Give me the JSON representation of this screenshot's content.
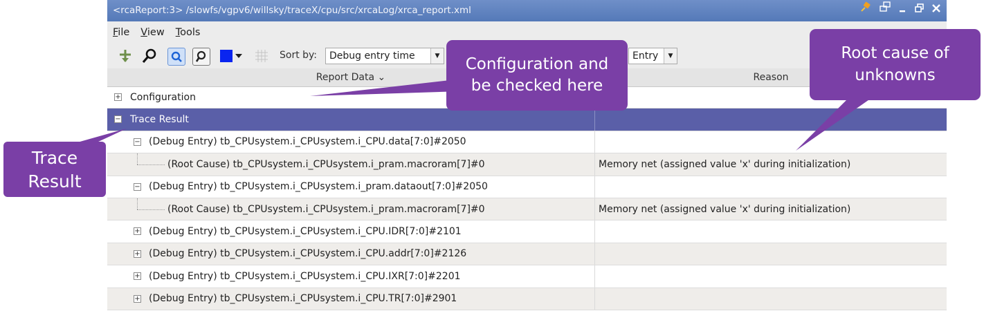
{
  "window": {
    "title": "<rcaReport:3> /slowfs/vgpv6/willsky/traceX/cpu/src/xrcaLog/xrca_report.xml"
  },
  "menu": [
    {
      "mnemonic": "F",
      "rest": "ile"
    },
    {
      "mnemonic": "V",
      "rest": "iew"
    },
    {
      "mnemonic": "T",
      "rest": "ools"
    }
  ],
  "toolbar": {
    "sort_label": "Sort by:",
    "sort_value": "Debug entry time",
    "second_value": "Entry"
  },
  "table": {
    "col1_header": "Report Data ⌄",
    "col2_header": "Reason",
    "rows": [
      {
        "label": "Configuration",
        "reason": ""
      },
      {
        "label": "Trace Result",
        "reason": ""
      },
      {
        "label": "(Debug Entry) tb_CPUsystem.i_CPUsystem.i_CPU.data[7:0]#2050",
        "reason": ""
      },
      {
        "label": "(Root Cause) tb_CPUsystem.i_CPUsystem.i_pram.macroram[7]#0",
        "reason": "Memory net (assigned value 'x' during initialization)"
      },
      {
        "label": "(Debug Entry) tb_CPUsystem.i_CPUsystem.i_pram.dataout[7:0]#2050",
        "reason": ""
      },
      {
        "label": "(Root Cause) tb_CPUsystem.i_CPUsystem.i_pram.macroram[7]#0",
        "reason": "Memory net (assigned value 'x' during initialization)"
      },
      {
        "label": "(Debug Entry) tb_CPUsystem.i_CPUsystem.i_CPU.IDR[7:0]#2101",
        "reason": ""
      },
      {
        "label": "(Debug Entry) tb_CPUsystem.i_CPUsystem.i_CPU.addr[7:0]#2126",
        "reason": ""
      },
      {
        "label": "(Debug Entry) tb_CPUsystem.i_CPUsystem.i_CPU.IXR[7:0]#2201",
        "reason": ""
      },
      {
        "label": "(Debug Entry) tb_CPUsystem.i_CPUsystem.i_CPU.TR[7:0]#2901",
        "reason": ""
      }
    ]
  },
  "callouts": {
    "configuration": [
      "Configuration and",
      "be checked here"
    ],
    "root_cause": [
      "Root cause of",
      "unknowns"
    ],
    "trace_result": [
      "Trace",
      "Result"
    ]
  },
  "colors": {
    "callout": "#7a3fa6",
    "selected_row": "#5a5fa8",
    "titlebar": "#5f82bf"
  }
}
